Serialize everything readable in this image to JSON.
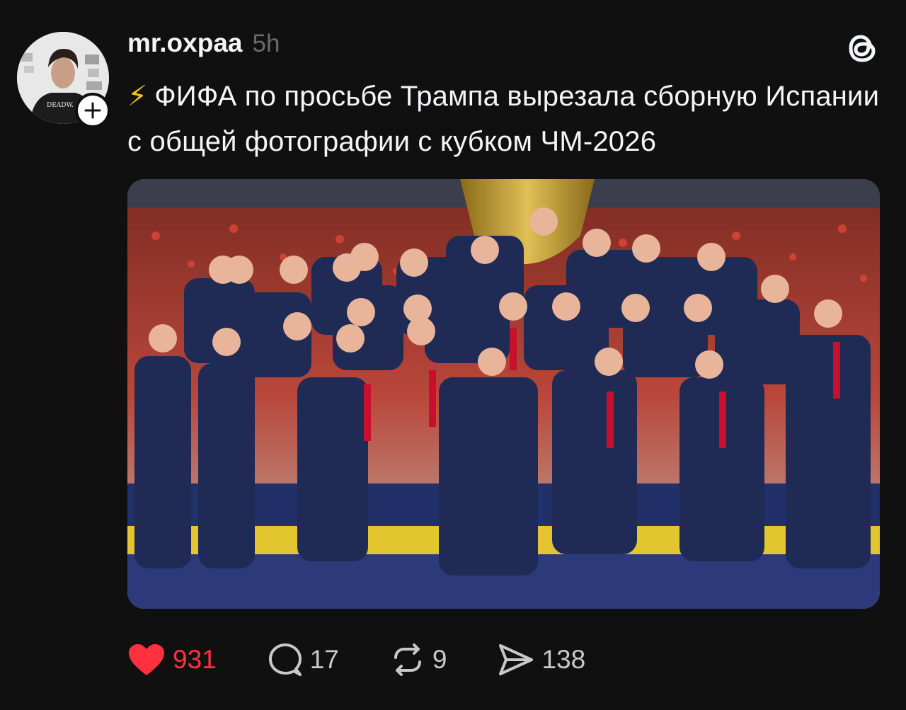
{
  "post": {
    "author": {
      "username": "mr.oxpaa",
      "avatar_text": "DEADW.",
      "follow_icon": "plus-icon"
    },
    "time": "5h",
    "platform_icon": "threads-logo-icon",
    "emoji": "⚡",
    "text": "ФИФА по просьбе Трампа вырезала сборную Испании с общей фотографии с кубком ЧМ-2026",
    "image": {
      "description_icon": "photo-image"
    },
    "actions": {
      "likes": {
        "count": "931",
        "icon": "heart-filled-icon",
        "color": "#ff3040"
      },
      "replies": {
        "count": "17",
        "icon": "comment-icon"
      },
      "reposts": {
        "count": "9",
        "icon": "repost-icon"
      },
      "shares": {
        "count": "138",
        "icon": "send-icon"
      }
    }
  },
  "colors": {
    "background": "#101010",
    "text": "#f3f5f7",
    "muted": "#6b6b6b",
    "like": "#ff3040",
    "bolt": "#f5c518"
  }
}
